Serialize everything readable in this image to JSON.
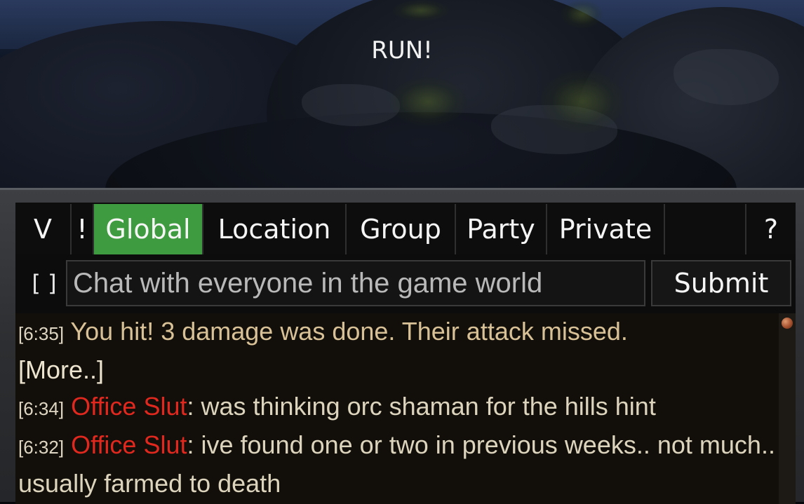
{
  "scene": {
    "caption": "RUN!"
  },
  "chat": {
    "tabs": [
      {
        "label": "V",
        "active": false
      },
      {
        "label": "!",
        "active": false
      },
      {
        "label": "Global",
        "active": true
      },
      {
        "label": "Location",
        "active": false
      },
      {
        "label": "Group",
        "active": false
      },
      {
        "label": "Party",
        "active": false
      },
      {
        "label": "Private",
        "active": false
      },
      {
        "label": "?",
        "active": false
      }
    ],
    "bracket_label": "[ ]",
    "input_placeholder": "Chat with everyone in the game world",
    "input_value": "",
    "submit_label": "Submit",
    "messages": [
      {
        "time": "[6:35]",
        "text": " You hit! 3 damage was done. Their attack missed."
      },
      {
        "more": "[More..]"
      },
      {
        "time": "[6:34]",
        "sender": "Office Slut",
        "text": ": was thinking orc shaman for the hills hint"
      },
      {
        "time": "[6:32]",
        "sender": "Office Slut",
        "text": ": ive found one or two in previous weeks.. not much.. usually farmed to death"
      }
    ],
    "colors": {
      "active_tab": "#3f9b3f",
      "sender": "#e0281e",
      "combat_text": "#d8c196",
      "panel": "#0c0c0c"
    }
  }
}
